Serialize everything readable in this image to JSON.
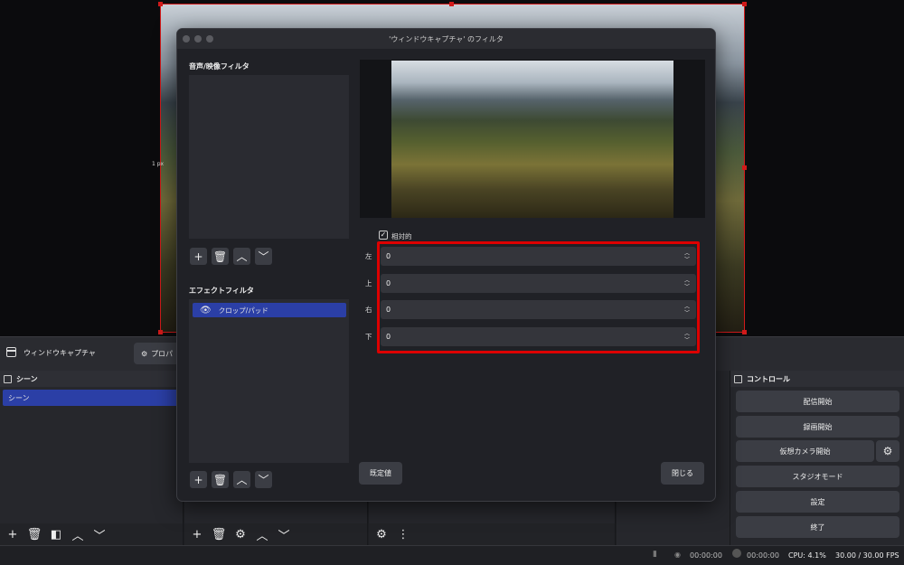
{
  "preview": {
    "edge_label": "1 px"
  },
  "source_bar": {
    "name": "ウィンドウキャプチャ",
    "properties_label": "プロパ"
  },
  "scenes": {
    "title": "シーン",
    "items": [
      "シーン"
    ]
  },
  "controls": {
    "title": "コントロール",
    "start_streaming": "配信開始",
    "start_recording": "録画開始",
    "start_virtual_camera": "仮想カメラ開始",
    "studio_mode": "スタジオモード",
    "settings": "設定",
    "exit": "終了"
  },
  "status": {
    "stream_time": "00:00:00",
    "record_time": "00:00:00",
    "cpu": "CPU: 4.1%",
    "fps": "30.00 / 30.00 FPS"
  },
  "dialog": {
    "title": "'ウィンドウキャプチャ' のフィルタ",
    "audio_video_filters_label": "音声/映像フィルタ",
    "effect_filters_label": "エフェクトフィルタ",
    "effect_filters": [
      "クロップ/パッド"
    ],
    "relative_label": "相対的",
    "relative_checked": true,
    "crop": {
      "left_label": "左",
      "left_value": "0",
      "top_label": "上",
      "top_value": "0",
      "right_label": "右",
      "right_value": "0",
      "bottom_label": "下",
      "bottom_value": "0"
    },
    "defaults_button": "既定値",
    "close_button": "閉じる"
  },
  "colors": {
    "accent": "#2b3fa6",
    "highlight": "#d00000",
    "selection_border": "#d11a1a"
  }
}
